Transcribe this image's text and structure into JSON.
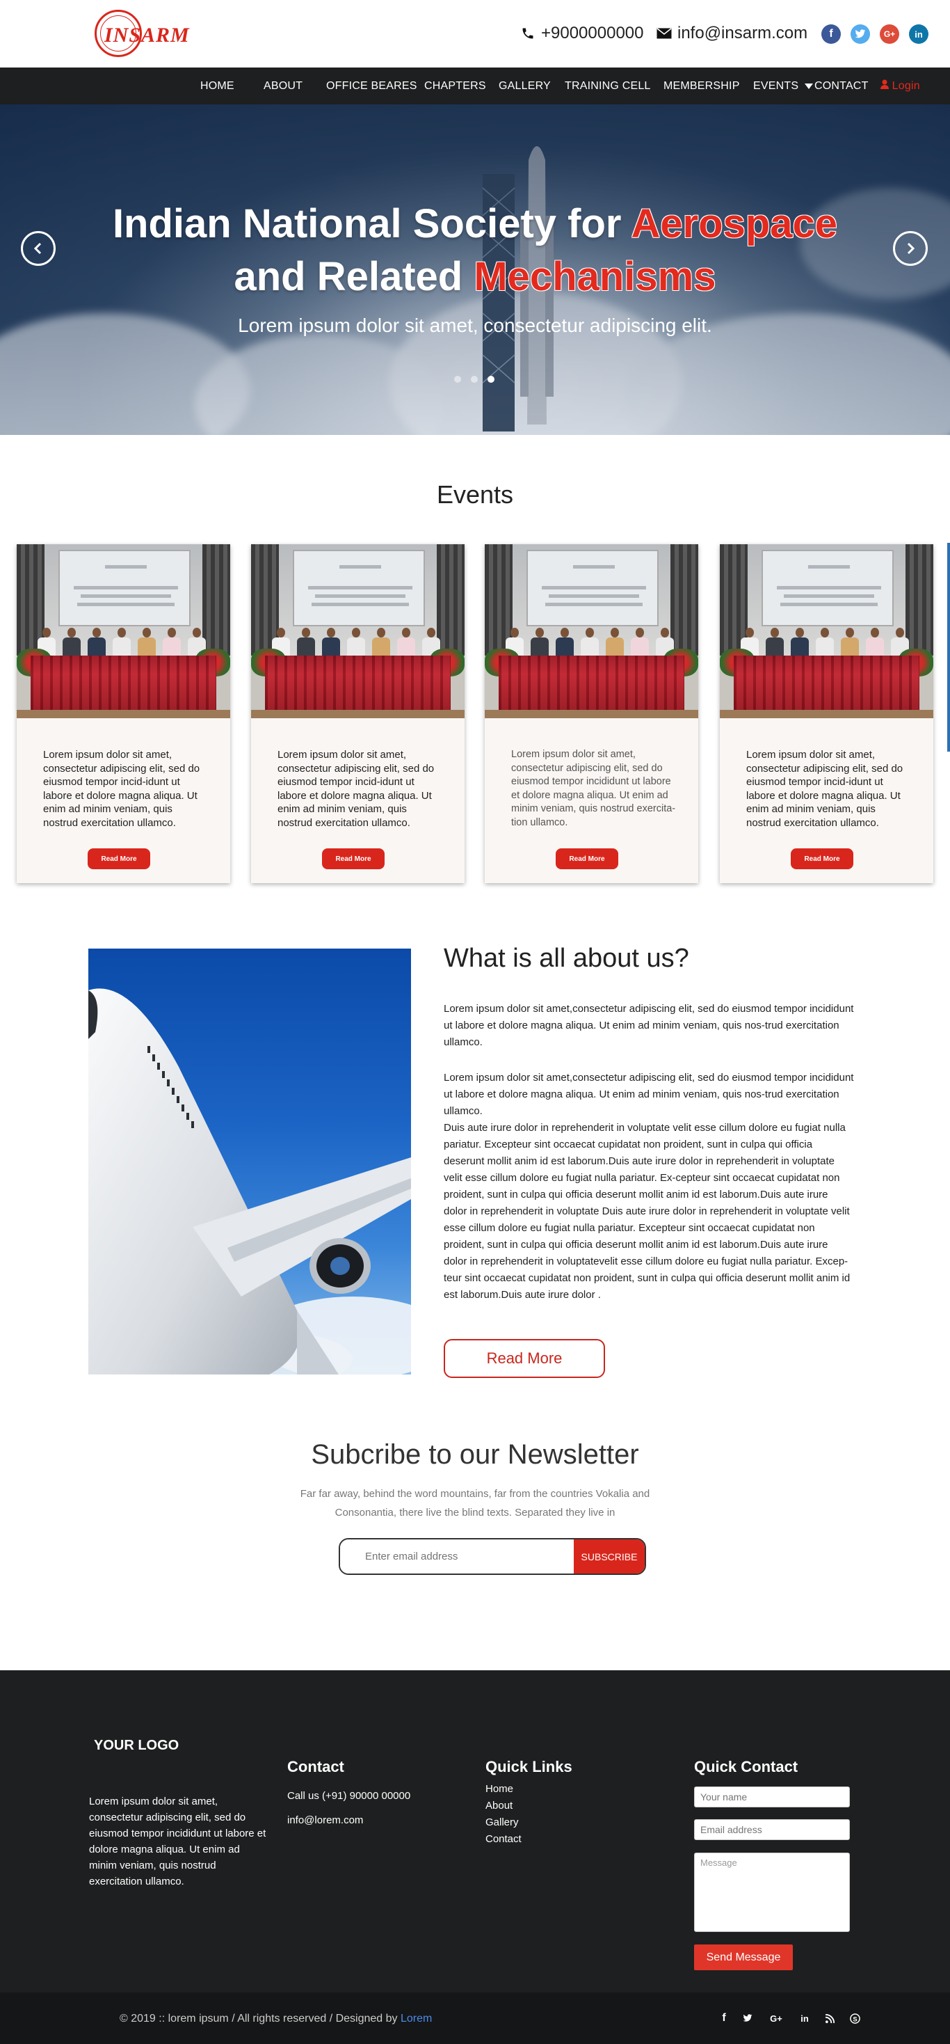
{
  "header": {
    "logo_text": "INSARM",
    "phone": "+9000000000",
    "email": "info@insarm.com",
    "social": [
      "facebook-icon",
      "twitter-icon",
      "google-plus-icon",
      "linkedin-icon"
    ]
  },
  "nav": {
    "items": [
      "HOME",
      "ABOUT",
      "OFFICE BEARES",
      "CHAPTERS",
      "GALLERY",
      "TRAINING CELL",
      "MEMBERSHIP",
      "EVENTS",
      "CONTACT"
    ],
    "login": "Login"
  },
  "hero": {
    "line1_pre": "Indian National Society for",
    "line1_accent": "Aerospace",
    "line2_pre": "and Related",
    "line2_accent": "Mechanisms",
    "subtitle": "Lorem ipsum dolor sit amet, consectetur adipiscing elit.",
    "slide_count": 3,
    "active_slide": 3
  },
  "events": {
    "title": "Events",
    "cards": [
      {
        "text": "Lorem ipsum dolor sit amet, consectetur adipiscing elit, sed do eiusmod tempor incid-idunt ut labore et dolore magna aliqua. Ut enim ad minim veniam, quis nostrud exercitation ullamco.",
        "button": "Read More"
      },
      {
        "text": "Lorem ipsum dolor sit amet, consectetur adipiscing elit, sed do eiusmod tempor incid-idunt ut labore et dolore magna aliqua. Ut enim ad minim veniam, quis nostrud exercitation ullamco.",
        "button": "Read More"
      },
      {
        "text": "Lorem ipsum dolor sit amet, consectetur adipiscing elit, sed do eiusmod tempor incididunt ut labore et dolore magna aliqua. Ut enim ad minim veniam, quis nostrud exercita-tion ullamco.",
        "button": "Read More"
      },
      {
        "text": "Lorem ipsum dolor sit amet, consectetur adipiscing elit, sed do eiusmod tempor incid-idunt ut labore et dolore magna aliqua. Ut enim ad minim veniam, quis nostrud exercitation ullamco.",
        "button": "Read More"
      }
    ]
  },
  "about": {
    "title": "What is all about us?",
    "p1": "Lorem ipsum dolor sit amet,consectetur adipiscing elit, sed do eiusmod tempor incididunt ut labore et dolore magna aliqua. Ut enim ad minim veniam, quis nos-trud exercitation ullamco.",
    "p2": "Lorem ipsum dolor sit amet,consectetur adipiscing elit, sed do eiusmod tempor incididunt ut labore et dolore magna aliqua. Ut enim ad minim veniam, quis nos-trud exercitation ullamco.",
    "p3": "Duis aute irure dolor in reprehenderit in voluptate velit esse cillum dolore eu fugiat nulla pariatur. Excepteur sint occaecat cupidatat non proident, sunt in culpa qui officia deserunt mollit anim id est laborum.Duis aute irure dolor in reprehenderit in voluptate velit esse cillum dolore eu fugiat nulla pariatur. Ex-cepteur sint occaecat cupidatat non proident, sunt in culpa qui officia deserunt mollit anim id est laborum.Duis aute irure dolor in reprehenderit in voluptate Duis aute irure dolor in reprehenderit in voluptate velit esse cillum dolore eu fugiat nulla pariatur. Excepteur sint occaecat cupidatat non proident, sunt in culpa qui officia deserunt mollit anim id est laborum.Duis aute irure dolor in reprehenderit in voluptatevelit esse cillum dolore eu fugiat nulla pariatur. Excep-teur sint occaecat cupidatat non proident, sunt in culpa qui officia deserunt mollit anim id est laborum.Duis aute irure dolor .",
    "button": "Read More"
  },
  "newsletter": {
    "title": "Subcribe to our Newsletter",
    "text": "Far far away, behind the word mountains, far from the countries Vokalia and Consonantia, there live the blind texts. Separated they live in",
    "placeholder": "Enter email address",
    "button": "SUBSCRIBE"
  },
  "footer": {
    "logo": "YOUR LOGO",
    "about": "Lorem ipsum dolor sit amet, consectetur adipiscing elit, sed do eiusmod tempor incididunt ut labore et dolore magna aliqua. Ut enim ad minim veniam, quis nostrud exercitation ullamco.",
    "contact_title": "Contact",
    "contact_phone": "Call us (+91) 90000 00000",
    "contact_email": "info@lorem.com",
    "links_title": "Quick Links",
    "links": [
      "Home",
      "About",
      "Gallery",
      "Contact"
    ],
    "quick_title": "Quick Contact",
    "name_placeholder": "Your name",
    "email_placeholder": "Email address",
    "message_placeholder": "Message",
    "send": "Send Message",
    "copyright": "© 2019 :: lorem ipsum / All rights reserved / Designed by",
    "designer": "Lorem",
    "bottom_social": [
      "facebook-icon",
      "twitter-icon",
      "google-plus-icon",
      "linkedin-icon",
      "rss-icon",
      "skype-icon"
    ]
  },
  "colors": {
    "accent": "#d9261c",
    "nav_bg": "#1e1f20",
    "footer_bg": "#1e1f20",
    "bottom_bar": "#151617",
    "link": "#4a8be8"
  }
}
